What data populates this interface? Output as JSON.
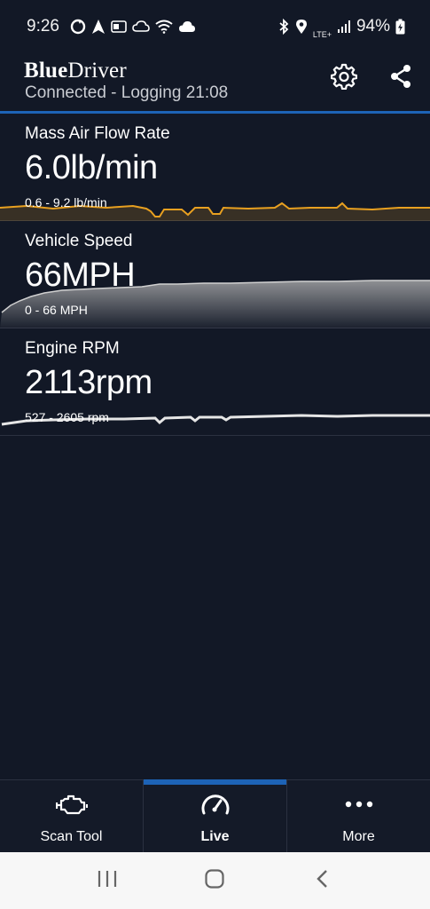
{
  "status": {
    "time": "9:26",
    "battery": "94%",
    "network": "LTE+"
  },
  "app": {
    "brand_bold": "Blue",
    "brand_regular": "Driver",
    "connection": "Connected - Logging 21:08"
  },
  "gauges": [
    {
      "label": "Mass Air Flow Rate",
      "value": "6.0lb/min",
      "range": "0.6 - 9.2 lb/min",
      "color": "#e8a020"
    },
    {
      "label": "Vehicle Speed",
      "value": "66MPH",
      "range": "0 - 66 MPH",
      "color": "#d0d0d0"
    },
    {
      "label": "Engine RPM",
      "value": "2113rpm",
      "range": "527 - 2605 rpm",
      "color": "#e6e6e6"
    }
  ],
  "nav": {
    "scan_tool": "Scan Tool",
    "live": "Live",
    "more": "More"
  },
  "colors": {
    "accent": "#1d63b6",
    "background": "#121826"
  }
}
